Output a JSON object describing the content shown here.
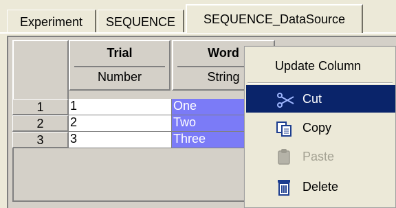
{
  "tabs": [
    {
      "label": "Experiment"
    },
    {
      "label": "SEQUENCE"
    },
    {
      "label": "SEQUENCE_DataSource"
    }
  ],
  "grid": {
    "columns": [
      {
        "name": "Trial",
        "type": "Number"
      },
      {
        "name": "Word",
        "type": "String"
      }
    ],
    "rows": [
      {
        "num": "1",
        "trial": "1",
        "word": "One"
      },
      {
        "num": "2",
        "trial": "2",
        "word": "Two"
      },
      {
        "num": "3",
        "trial": "3",
        "word": "Three"
      }
    ]
  },
  "context_menu": {
    "items": [
      {
        "label": "Update Column",
        "icon": "none",
        "state": "normal"
      },
      {
        "label": "Cut",
        "icon": "scissors-icon",
        "state": "highlighted"
      },
      {
        "label": "Copy",
        "icon": "copy-icon",
        "state": "normal"
      },
      {
        "label": "Paste",
        "icon": "paste-icon",
        "state": "disabled"
      },
      {
        "label": "Delete",
        "icon": "trash-icon",
        "state": "normal"
      }
    ]
  },
  "colors": {
    "selection": "#7b7bf7",
    "menu_highlight": "#0a246a",
    "face": "#ece9d8"
  }
}
